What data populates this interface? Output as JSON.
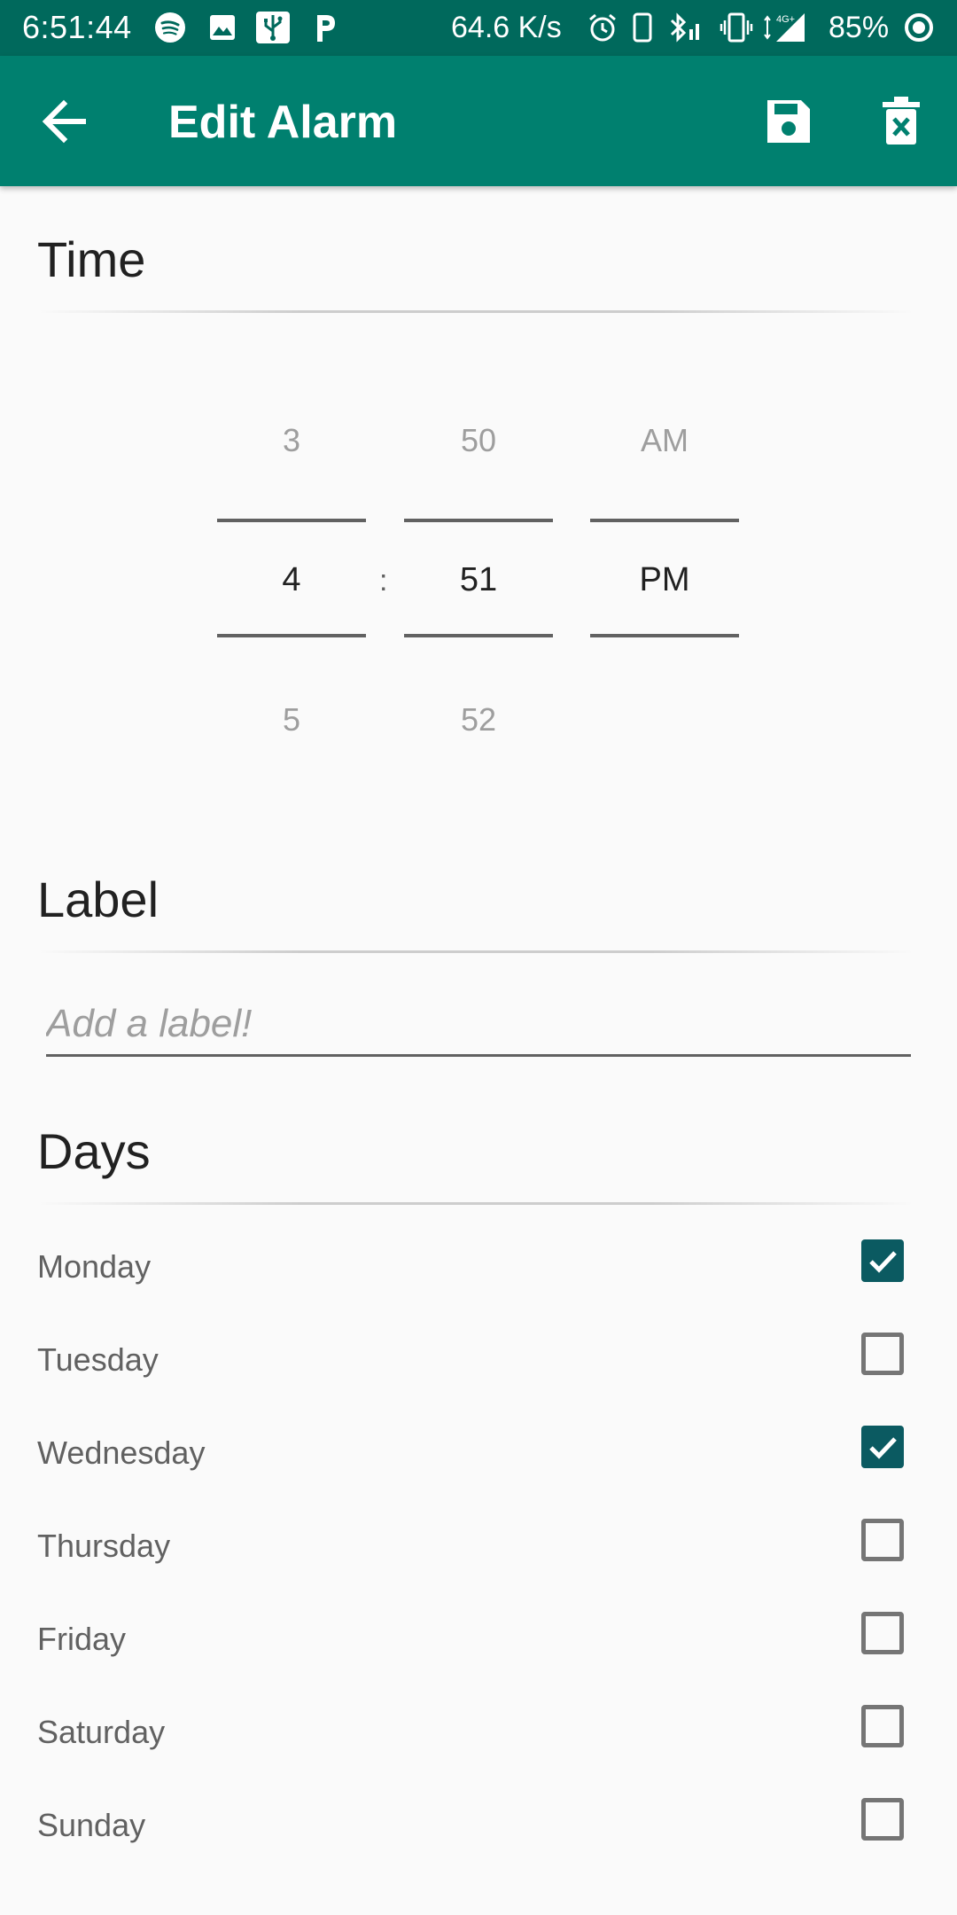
{
  "status_bar": {
    "time": "6:51:44",
    "net_speed": "64.6 K/s",
    "battery": "85%",
    "icons": [
      "spotify-icon",
      "image-icon",
      "usb-icon",
      "parking-icon",
      "alarm-icon",
      "phone-icon",
      "bluetooth-icon",
      "vibrate-icon",
      "signal-4g-icon",
      "battery-ring-icon"
    ]
  },
  "toolbar": {
    "title": "Edit Alarm",
    "back_icon": "arrow-left-icon",
    "save_icon": "floppy-disk-icon",
    "delete_icon": "trash-x-icon",
    "background": "#00806f"
  },
  "time_section": {
    "title": "Time",
    "hour": {
      "prev": "3",
      "selected": "4",
      "next": "5"
    },
    "separator": ":",
    "minute": {
      "prev": "50",
      "selected": "51",
      "next": "52"
    },
    "ampm": {
      "prev": "AM",
      "selected": "PM",
      "next": ""
    }
  },
  "label_section": {
    "title": "Label",
    "placeholder": "Add a label!",
    "value": ""
  },
  "days_section": {
    "title": "Days",
    "days": [
      {
        "name": "Monday",
        "checked": true
      },
      {
        "name": "Tuesday",
        "checked": false
      },
      {
        "name": "Wednesday",
        "checked": true
      },
      {
        "name": "Thursday",
        "checked": false
      },
      {
        "name": "Friday",
        "checked": false
      },
      {
        "name": "Saturday",
        "checked": false
      },
      {
        "name": "Sunday",
        "checked": false
      }
    ]
  },
  "colors": {
    "status_bar": "#00695c",
    "accent": "#0b5a61",
    "text_secondary": "#616161"
  }
}
